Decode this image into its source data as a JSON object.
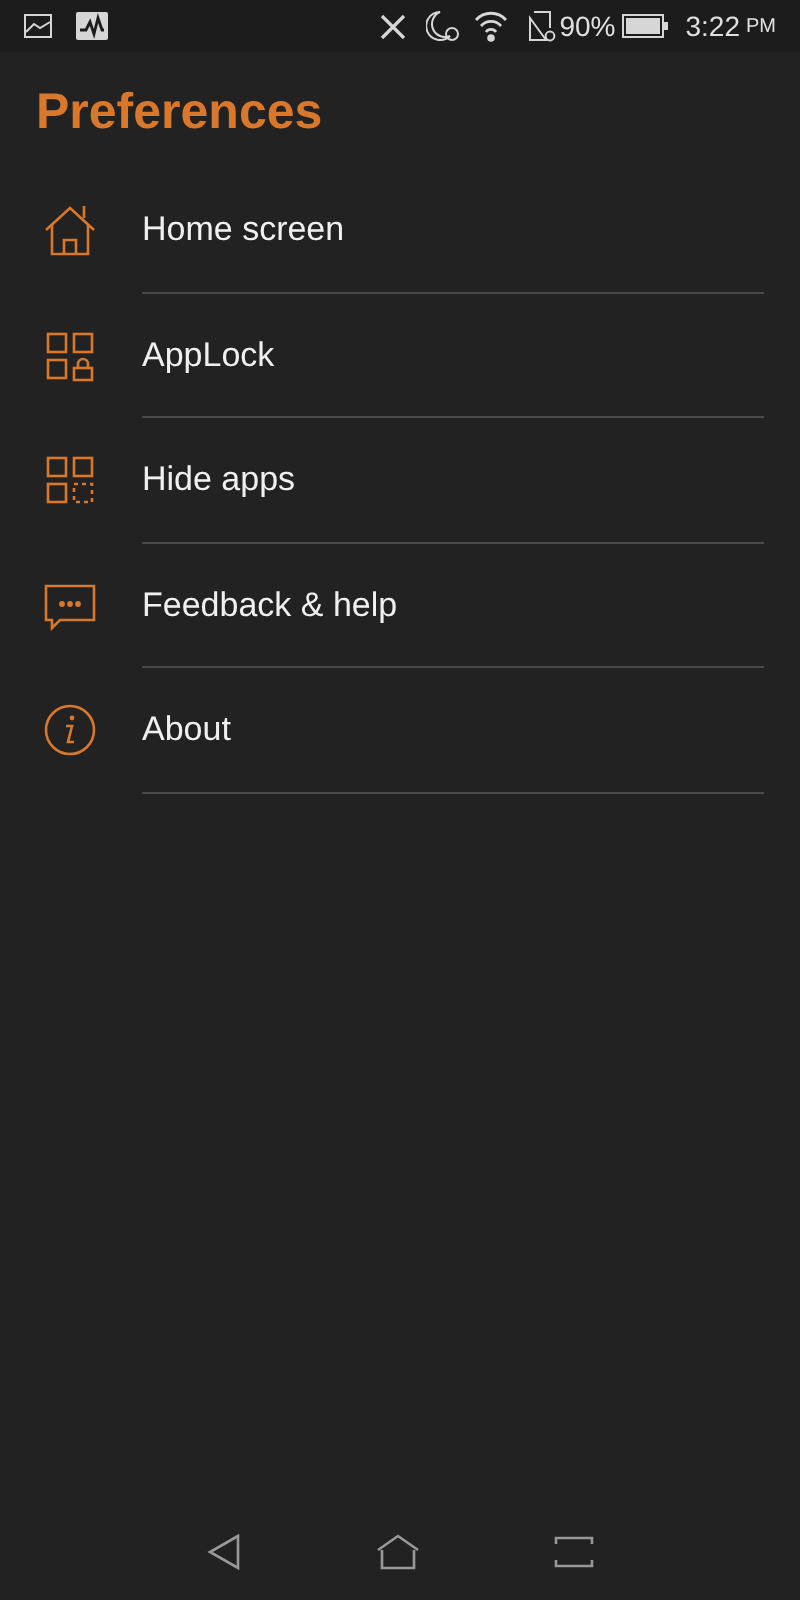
{
  "status_bar": {
    "battery_percent": "90%",
    "time": "3:22",
    "time_suffix": "PM"
  },
  "title": "Preferences",
  "items": [
    {
      "kind": "home",
      "label": "Home screen"
    },
    {
      "kind": "applock",
      "label": "AppLock"
    },
    {
      "kind": "hide",
      "label": "Hide apps"
    },
    {
      "kind": "feedback",
      "label": "Feedback & help"
    },
    {
      "kind": "about",
      "label": "About"
    }
  ]
}
